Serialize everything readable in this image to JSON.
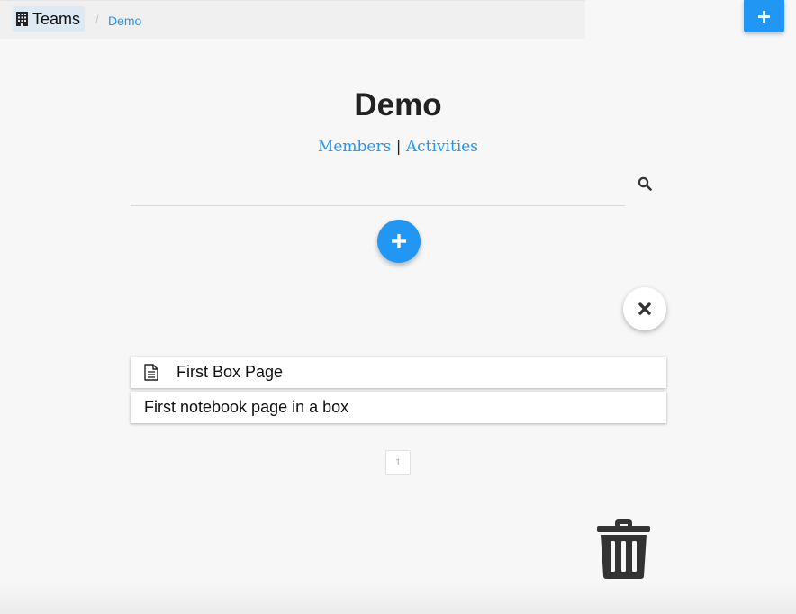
{
  "breadcrumb": {
    "teams_label": "Teams",
    "separator": "/",
    "current": "Demo",
    "teams_icon": "building-icon"
  },
  "top_add_button": {
    "icon": "plus-icon"
  },
  "page": {
    "title": "Demo",
    "nav": {
      "members": "Members",
      "divider": "|",
      "activities": "Activities"
    }
  },
  "search": {
    "placeholder": "",
    "value": "",
    "icon": "search-icon"
  },
  "add_fab": {
    "icon": "plus-icon"
  },
  "close_fab": {
    "icon": "close-icon"
  },
  "items": [
    {
      "label": "First Box Page",
      "icon": "document-icon"
    },
    {
      "label": "First notebook page in a box"
    }
  ],
  "pagination": {
    "current_page": "1"
  },
  "trash": {
    "icon": "trash-icon"
  },
  "colors": {
    "accent": "#2196f3",
    "background": "#f7f7f7",
    "text": "#222222"
  }
}
